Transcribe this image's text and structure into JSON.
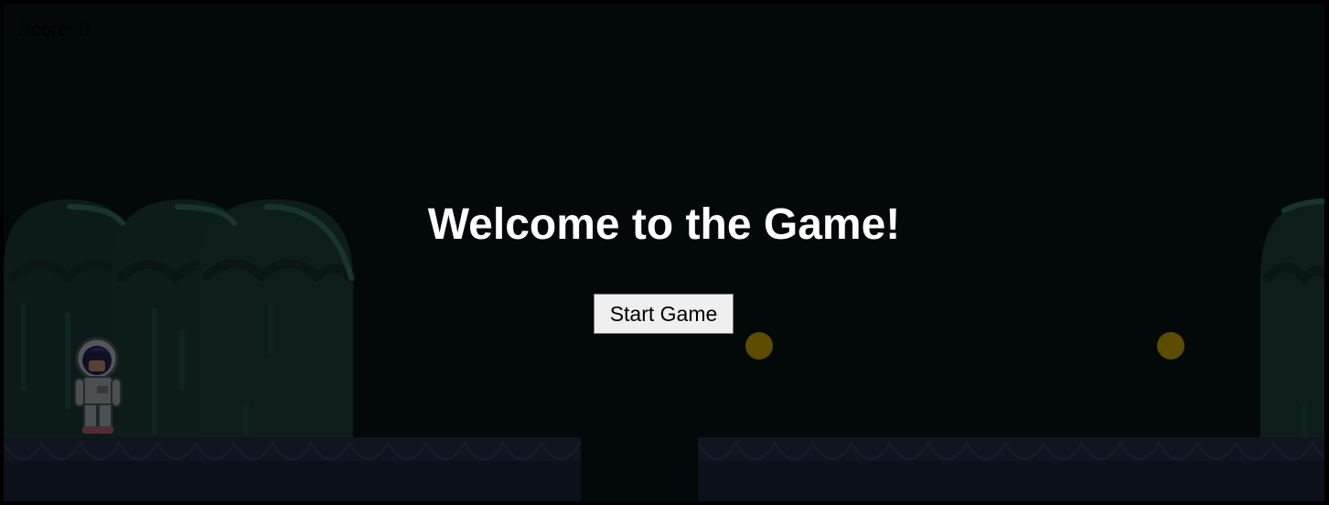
{
  "hud": {
    "score_label": "Score:",
    "score_value": "0"
  },
  "menu": {
    "title": "Welcome to the Game!",
    "start_button_label": "Start Game"
  },
  "scene": {
    "coins_visible": 2,
    "player_character": "astronaut-icon",
    "platform_color": "#2a3552",
    "bush_color": "#23483f",
    "coin_color": "#f5c400"
  }
}
